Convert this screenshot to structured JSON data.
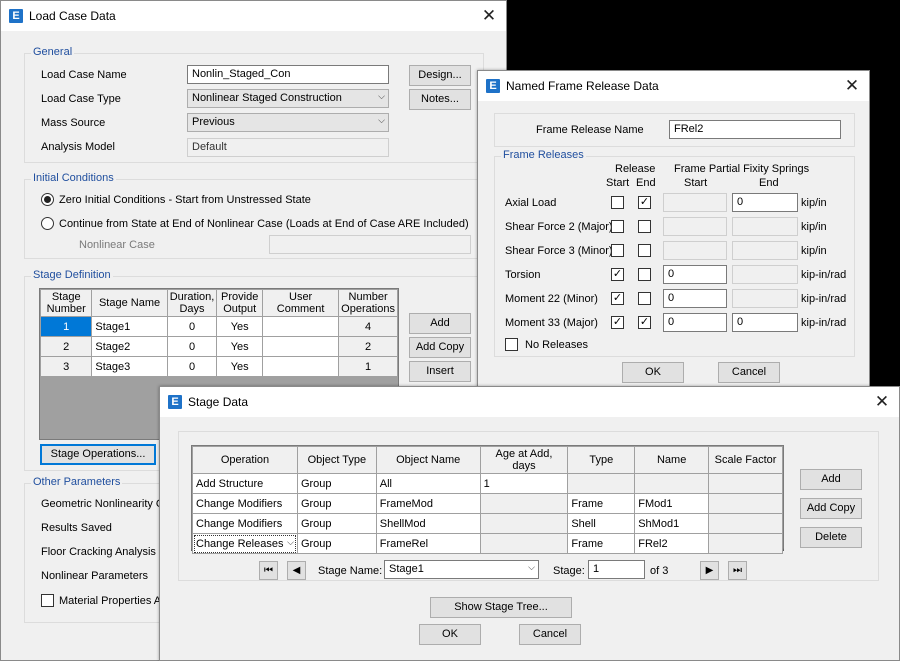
{
  "load_case": {
    "title": "Load Case Data",
    "general": {
      "legend": "General",
      "name_label": "Load Case Name",
      "name_value": "Nonlin_Staged_Con",
      "type_label": "Load Case Type",
      "type_value": "Nonlinear Staged Construction",
      "mass_label": "Mass Source",
      "mass_value": "Previous",
      "model_label": "Analysis Model",
      "model_value": "Default",
      "design_btn": "Design...",
      "notes_btn": "Notes..."
    },
    "initial": {
      "legend": "Initial Conditions",
      "opt1": "Zero Initial Conditions - Start from Unstressed State",
      "opt2": "Continue from State at End of Nonlinear Case  (Loads at End of Case ARE Included)",
      "nonlin_label": "Nonlinear Case"
    },
    "stage_def": {
      "legend": "Stage Definition",
      "headers": [
        "Stage Number",
        "Stage Name",
        "Duration, Days",
        "Provide Output",
        "User Comment",
        "Number Operations"
      ],
      "rows": [
        [
          "1",
          "Stage1",
          "0",
          "Yes",
          "",
          "4"
        ],
        [
          "2",
          "Stage2",
          "0",
          "Yes",
          "",
          "2"
        ],
        [
          "3",
          "Stage3",
          "0",
          "Yes",
          "",
          "1"
        ]
      ],
      "add_btn": "Add",
      "addcopy_btn": "Add Copy",
      "insert_btn": "Insert",
      "ops_btn": "Stage Operations..."
    },
    "other": {
      "legend": "Other Parameters",
      "items": [
        "Geometric Nonlinearity Opti",
        "Results Saved",
        "Floor Cracking Analysis",
        "Nonlinear Parameters",
        "Material Properties Are"
      ]
    }
  },
  "frame_release": {
    "title": "Named Frame Release Data",
    "name_label": "Frame Release Name",
    "name_value": "FRel2",
    "legend": "Frame Releases",
    "hdr_release": "Release",
    "hdr_start": "Start",
    "hdr_end": "End",
    "hdr_springs": "Frame Partial Fixity Springs",
    "hdr_spr_start": "Start",
    "hdr_spr_end": "End",
    "rows": [
      {
        "label": "Axial Load",
        "start": false,
        "end": true,
        "spr_start": "",
        "spr_end": "0",
        "unit": "kip/in"
      },
      {
        "label": "Shear Force 2 (Major)",
        "start": false,
        "end": false,
        "spr_start": "",
        "spr_end": "",
        "unit": "kip/in"
      },
      {
        "label": "Shear Force 3 (Minor)",
        "start": false,
        "end": false,
        "spr_start": "",
        "spr_end": "",
        "unit": "kip/in"
      },
      {
        "label": "Torsion",
        "start": true,
        "end": false,
        "spr_start": "0",
        "spr_end": "",
        "unit": "kip-in/rad"
      },
      {
        "label": "Moment 22 (Minor)",
        "start": true,
        "end": false,
        "spr_start": "0",
        "spr_end": "",
        "unit": "kip-in/rad"
      },
      {
        "label": "Moment 33 (Major)",
        "start": true,
        "end": true,
        "spr_start": "0",
        "spr_end": "0",
        "unit": "kip-in/rad"
      }
    ],
    "no_releases": "No Releases",
    "ok": "OK",
    "cancel": "Cancel"
  },
  "stage_data": {
    "title": "Stage Data",
    "headers": [
      "Operation",
      "Object Type",
      "Object Name",
      "Age at Add, days",
      "Type",
      "Name",
      "Scale Factor"
    ],
    "rows": [
      [
        "Add Structure",
        "Group",
        "All",
        "1",
        "",
        "",
        ""
      ],
      [
        "Change Modifiers",
        "Group",
        "FrameMod",
        "",
        "Frame",
        "FMod1",
        ""
      ],
      [
        "Change Modifiers",
        "Group",
        "ShellMod",
        "",
        "Shell",
        "ShMod1",
        ""
      ],
      [
        "Change Releases",
        "Group",
        "FrameRel",
        "",
        "Frame",
        "FRel2",
        ""
      ]
    ],
    "add_btn": "Add",
    "addcopy_btn": "Add Copy",
    "delete_btn": "Delete",
    "stage_name_label": "Stage Name:",
    "stage_name_value": "Stage1",
    "stage_label": "Stage:",
    "stage_value": "1",
    "of_text": "of 3",
    "tree_btn": "Show Stage Tree...",
    "ok": "OK",
    "cancel": "Cancel"
  }
}
